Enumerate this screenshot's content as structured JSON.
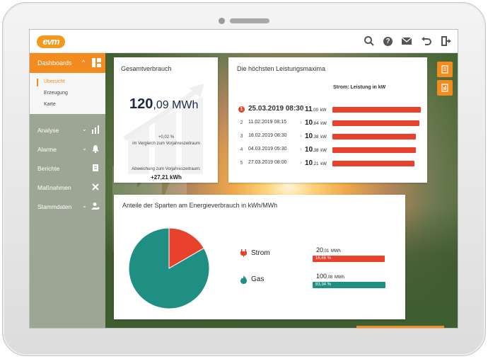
{
  "header": {
    "logo_text": "evm",
    "icons": [
      "search-icon",
      "help-icon",
      "mail-icon",
      "undo-icon",
      "logout-icon"
    ],
    "help_glyph": "?"
  },
  "sidebar": {
    "dashboards": {
      "label": "Dashboards",
      "chevron": "^"
    },
    "sub_items": [
      "Übersicht",
      "Erzeugung",
      "Karte"
    ],
    "items": [
      {
        "label": "Analyse",
        "icon": "bar-chart-icon"
      },
      {
        "label": "Alarme",
        "icon": "bell-icon"
      },
      {
        "label": "Berichte",
        "icon": "report-icon"
      },
      {
        "label": "Maßnahmen",
        "icon": "tools-icon"
      },
      {
        "label": "Stammdaten",
        "icon": "user-settings-icon"
      }
    ]
  },
  "gesamt": {
    "title": "Gesamtverbrauch",
    "value_int": "120",
    "value_dec": ",09",
    "value_unit": " MWh",
    "change_pct": "+0,02 %",
    "change_text": "im Vergleich zum Vorjahreszeitraum",
    "deviation_label": "Abweichung zum Vorjahreszeitraum:",
    "deviation_value": "+27,21 kWh"
  },
  "maxima": {
    "title": "Die höchsten Leistungsmaxima",
    "column_header": "Strom: Leistung in kW",
    "unit": "kW",
    "rows": [
      {
        "rank": "1",
        "date": "25.03.2019 08:30",
        "value_int": "11",
        "value_dec": ",00",
        "value": 11.0
      },
      {
        "rank": "2",
        "date": "11.02.2019 08:15",
        "value_int": "10",
        "value_dec": ",84",
        "value": 10.84
      },
      {
        "rank": "3",
        "date": "18.02.2019 08:30",
        "value_int": "10",
        "value_dec": ",38",
        "value": 10.38
      },
      {
        "rank": "4",
        "date": "04.03.2019 05:30",
        "value_int": "10",
        "value_dec": ",38",
        "value": 10.38
      },
      {
        "rank": "5",
        "date": "27.03.2019 08:00",
        "value_int": "10",
        "value_dec": ",21",
        "value": 10.21
      }
    ]
  },
  "anteile": {
    "title": "Anteile der Sparten am Energieverbrauch in kWh/MWh",
    "strom": {
      "label": "Strom",
      "value_int": "20",
      "value_dec": ",01",
      "unit": "MWh",
      "pct": "16,66 %",
      "share": 16.66,
      "color": "#e8412c",
      "icon": "plug-icon"
    },
    "gas": {
      "label": "Gas",
      "value_int": "100",
      "value_dec": ",08",
      "unit": "MWh",
      "pct": "83,34 %",
      "share": 83.34,
      "color": "#1f8f83",
      "icon": "flame-icon"
    }
  },
  "chart_data": {
    "type": "pie",
    "title": "Anteile der Sparten am Energieverbrauch in kWh/MWh",
    "categories": [
      "Strom",
      "Gas"
    ],
    "values": [
      16.66,
      83.34
    ],
    "colors": [
      "#e8412c",
      "#1f8f83"
    ]
  },
  "side_buttons": [
    "document-icon",
    "report-export-icon"
  ]
}
